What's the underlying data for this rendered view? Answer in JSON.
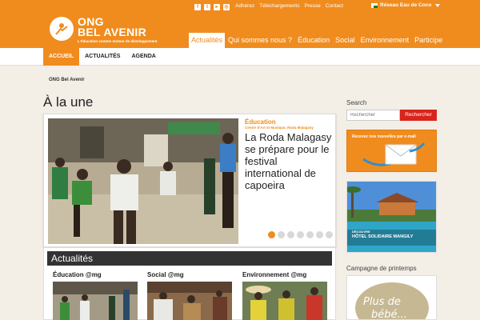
{
  "header": {
    "logo_name_1": "ONG",
    "logo_name_2": "BEL AVENIR",
    "logo_tagline": "L'éducation comme moteur de développement",
    "top_links": [
      "Adhérez",
      "Téléchargements",
      "Presse",
      "Contact"
    ],
    "reseau": "Réseau Eau de Coco",
    "nav": [
      "Actualités",
      "Qui sommes nous ?",
      "Éducation",
      "Social",
      "Environnement",
      "Participe"
    ],
    "nav_active": "Actualités",
    "brand_color": "#f08c1e"
  },
  "subnav": [
    "ACCUEIL",
    "ACTUALITÉS",
    "AGENDA"
  ],
  "breadcrumb": "ONG Bel Avenir",
  "page_title": "À la une",
  "slide": {
    "category": "Éducation",
    "subcategory": "Centre d'Art et Musique, Roda Malagasy",
    "title": "La Roda Malagasy se prépare pour le festival international de capoeira",
    "dots": 7,
    "active_dot": 1
  },
  "actualites": {
    "heading": "Actualités",
    "columns": [
      "Éducation @mg",
      "Social @mg",
      "Environnement @mg"
    ]
  },
  "sidebar": {
    "search_heading": "Search",
    "search_placeholder": "Rechercher",
    "search_button": "Rechercher",
    "newsletter_text": "Recevez nos nouvelles par e-mail",
    "hotel_caption_1": "DÉCOUVRE",
    "hotel_caption_2": "HÔTEL SOLIDAIRE MANGILY",
    "campagne_heading": "Campagne de printemps"
  }
}
